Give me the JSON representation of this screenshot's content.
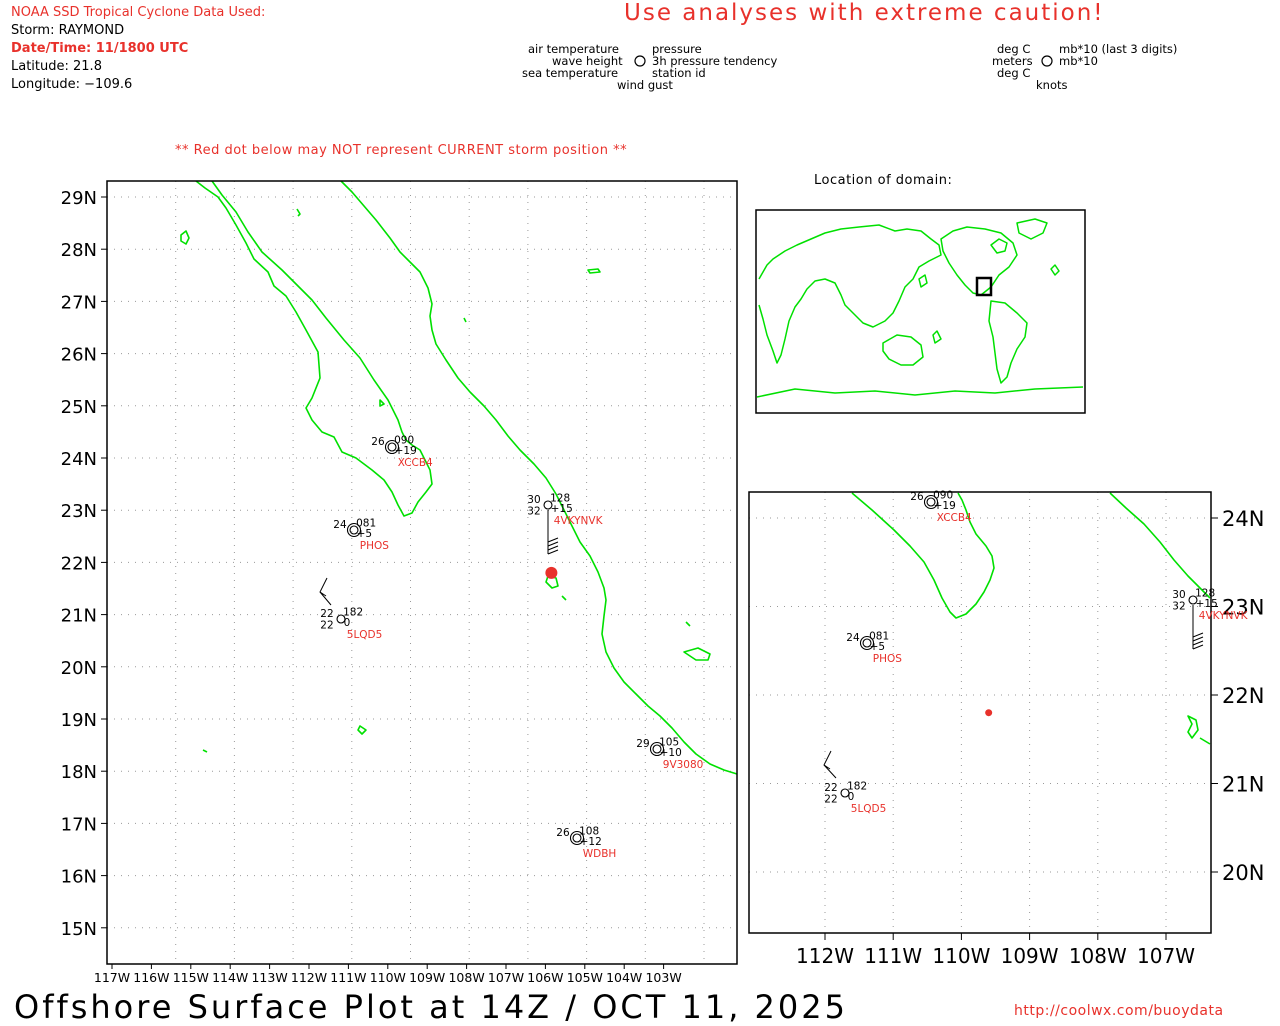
{
  "header": {
    "source_label": "NOAA SSD Tropical Cyclone Data Used:",
    "storm": "Storm: RAYMOND",
    "datetime": "Date/Time: 11/1800 UTC",
    "latitude": "Latitude: 21.8",
    "longitude": "Longitude: −109.6"
  },
  "caution": "Use analyses with extreme caution!",
  "legend": {
    "left": {
      "air_temperature": "air temperature",
      "wave_height": "wave height",
      "sea_temperature": "sea temperature",
      "pressure": "pressure",
      "pressure_tendency": "3h pressure tendency",
      "station_id": "station id",
      "wind_gust": "wind gust"
    },
    "right": {
      "deg_c_top": "deg C",
      "meters": "meters",
      "deg_c_bottom": "deg C",
      "mb10_last3": "mb*10 (last 3 digits)",
      "mb10": "mb*10",
      "knots": "knots"
    }
  },
  "warning": "** Red dot below may NOT represent CURRENT storm position **",
  "location_title": "Location of domain:",
  "main_map": {
    "lat_labels": [
      "29N",
      "28N",
      "27N",
      "26N",
      "25N",
      "24N",
      "23N",
      "22N",
      "21N",
      "20N",
      "19N",
      "18N",
      "17N",
      "16N",
      "15N"
    ],
    "lon_labels": [
      "117W",
      "116W",
      "115W",
      "114W",
      "113W",
      "112W",
      "111W",
      "110W",
      "109W",
      "108W",
      "107W",
      "106W",
      "105W",
      "104W",
      "103W"
    ],
    "storm_marker": {
      "lat": 21.8,
      "lon": -109.6,
      "color": "#e8312b"
    }
  },
  "stations": [
    {
      "id": "XCCB4",
      "air_temp": "26",
      "pressure": "090",
      "tendency": "+19",
      "lat": 24.2,
      "lon": -110.3
    },
    {
      "id": "4VKYNVK",
      "air_temp": "30",
      "sea_temp": "32",
      "pressure": "128",
      "tendency": "+15",
      "lat": 23.1,
      "lon": -107.0
    },
    {
      "id": "PHOS",
      "air_temp": "24",
      "pressure": "081",
      "tendency": "+5",
      "lat": 22.6,
      "lon": -111.1
    },
    {
      "id": "5LQD5",
      "air_temp": "22",
      "sea_temp": "22",
      "pressure": "182",
      "tendency": "0",
      "lat": 20.9,
      "lon": -111.3
    },
    {
      "id": "9V3080",
      "air_temp": "29",
      "pressure": "105",
      "tendency": "+10",
      "lat": 18.4,
      "lon": -104.0
    },
    {
      "id": "WDBH",
      "air_temp": "26",
      "pressure": "108",
      "tendency": "+12",
      "lat": 16.7,
      "lon": -106.0
    }
  ],
  "zoom_map": {
    "lat_labels": [
      "24N",
      "23N",
      "22N",
      "21N",
      "20N"
    ],
    "lon_labels": [
      "112W",
      "111W",
      "110W",
      "109W",
      "108W",
      "107W"
    ]
  },
  "footer": {
    "title": "Offshore Surface Plot at 14Z / OCT 11, 2025",
    "url": "http://coolwx.com/buoydata"
  },
  "colors": {
    "coast": "#00e000",
    "label_red": "#e8312b",
    "grid": "#9a9a9a"
  }
}
